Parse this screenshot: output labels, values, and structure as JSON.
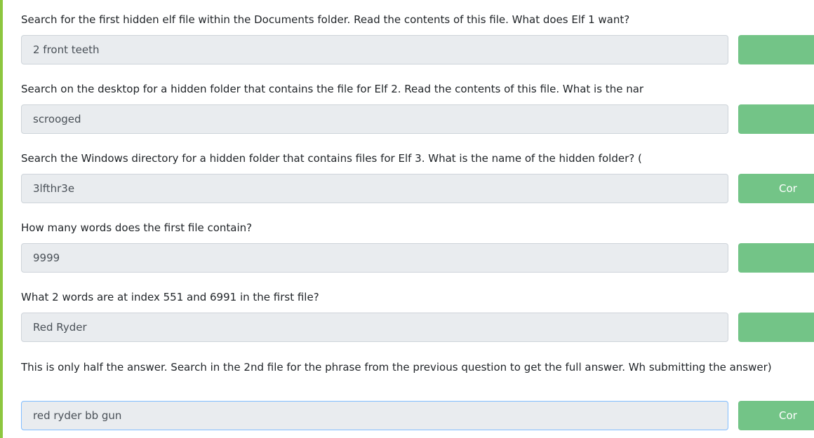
{
  "questions": [
    {
      "text": "Search for the first hidden elf file within the Documents folder. Read the contents of this file. What does Elf 1 want?",
      "answer": "2 front teeth",
      "button_label": ""
    },
    {
      "text": "Search on the desktop for a hidden folder that contains the file for Elf 2. Read the contents of this file. What is the nar",
      "answer": "scrooged",
      "button_label": ""
    },
    {
      "text": "Search the Windows directory for a hidden folder that contains files for Elf 3. What is the name of the hidden folder? (",
      "answer": "3lfthr3e",
      "button_label": "Cor"
    },
    {
      "text": "How many words does the first file contain?",
      "answer": "9999",
      "button_label": ""
    },
    {
      "text": "What 2 words are at index 551 and 6991 in the first file?",
      "answer": "Red Ryder",
      "button_label": ""
    },
    {
      "text": "This is only half the answer. Search in the 2nd file for the phrase from the previous question to get the full answer. Wh submitting the answer)",
      "answer": "red ryder bb gun",
      "button_label": "Cor"
    }
  ],
  "colors": {
    "accent": "#8dc63f",
    "button": "#73c487",
    "input_bg": "#e9ecef"
  }
}
